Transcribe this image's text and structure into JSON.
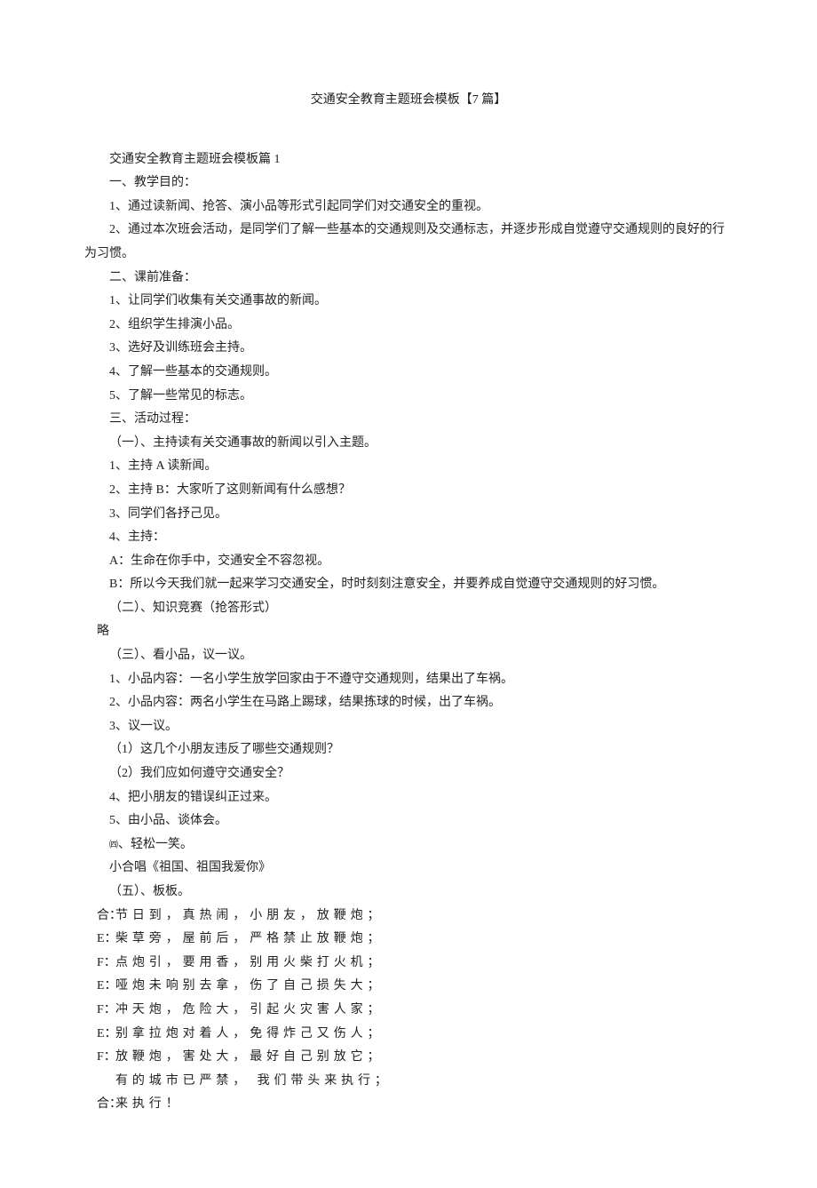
{
  "title": "交通安全教育主题班会模板【7 篇】",
  "lines": {
    "l1": "交通安全教育主题班会模板篇 1",
    "l2": "一、教学目的：",
    "l3": "1、通过读新闻、抢答、演小品等形式引起同学们对交通安全的重视。",
    "l4": "2、通过本次班会活动，是同学们了解一些基本的交通规则及交通标志，并逐步形成自觉遵守交通规则的良好的行为习惯。",
    "l5": "二、课前准备：",
    "l6": "1、让同学们收集有关交通事故的新闻。",
    "l7": "2、组织学生排演小品。",
    "l8": "3、选好及训练班会主持。",
    "l9": "4、了解一些基本的交通规则。",
    "l10": "5、了解一些常见的标志。",
    "l11": "三、活动过程：",
    "l12": "（一）、主持读有关交通事故的新闻以引入主题。",
    "l13": "1、主持 A 读新闻。",
    "l14": "2、主持 B：大家听了这则新闻有什么感想？",
    "l15": "3、同学们各抒己见。",
    "l16": "4、主持：",
    "l17": "A：生命在你手中，交通安全不容忽视。",
    "l18": "B：所以今天我们就一起来学习交通安全，时时刻刻注意安全，并要养成自觉遵守交通规则的好习惯。",
    "l19": "（二）、知识竞赛（抢答形式）",
    "l20": "略",
    "l21": "（三）、看小品，议一议。",
    "l22": "1、小品内容：一名小学生放学回家由于不遵守交通规则，结果出了车祸。",
    "l23": "2、小品内容：两名小学生在马路上踢球，结果拣球的时候，出了车祸。",
    "l24": "3、议一议。",
    "l25": "（1）这几个小朋友违反了哪些交通规则？",
    "l26": "（2）我们应如何遵守交通安全？",
    "l27": "4、把小朋友的错误纠正过来。",
    "l28": "5、由小品、谈体会。",
    "l29a": "㈣",
    "l29b": "、轻松一笑。",
    "l30": "小合唱《祖国、祖国我爱你》",
    "l31": "（五）、板板。",
    "kb": {
      "r1role": "合：",
      "r1text": "节日到，真热闹，小朋友，放鞭炮；",
      "r2role": "E：",
      "r2text": "柴草旁，屋前后，严格禁止放鞭炮；",
      "r3role": "F：",
      "r3text": "点炮引，要用香，别用火柴打火机；",
      "r4role": "E：",
      "r4text": "哑炮未响别去拿，伤了自己损失大；",
      "r5role": "F：",
      "r5text": "冲天炮，危险大，引起火灾害人家；",
      "r6role": "E：",
      "r6text": "别拿拉炮对着人，免得炸己又伤人；",
      "r7role": "F：",
      "r7text": "放鞭炮，害处大，最好自己别放它；",
      "r8role": "",
      "r8text": "有的城市已严禁，  我们带头来执行；",
      "r9role": "合：",
      "r9text": "来执行！"
    }
  }
}
